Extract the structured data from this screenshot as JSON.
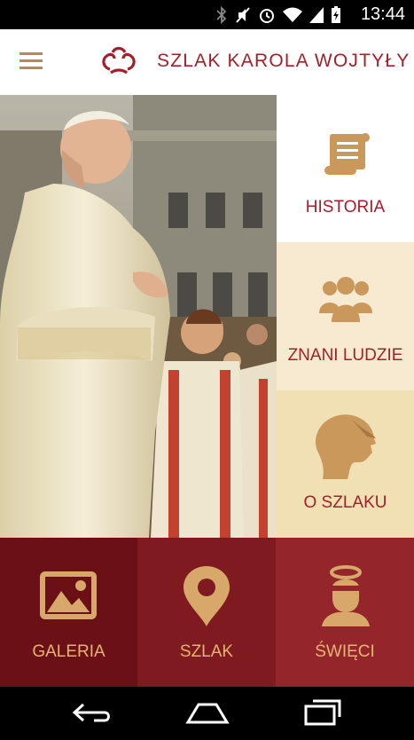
{
  "status_bar": {
    "time": "13:44",
    "icons": [
      "bluetooth-icon",
      "mute-icon",
      "alarm-icon",
      "wifi-icon",
      "signal-icon",
      "battery-charging-icon"
    ]
  },
  "app_bar": {
    "title": "SZLAK KAROLA WOJTYŁY",
    "menu_icon": "hamburger-menu-icon",
    "logo_icon": "logo-icon"
  },
  "tiles": {
    "historia": {
      "label": "HISTORIA",
      "icon": "scroll-icon"
    },
    "znani_ludzie": {
      "label": "ZNANI LUDZIE",
      "icon": "people-group-icon"
    },
    "o_szlaku": {
      "label": "O SZLAKU",
      "icon": "profile-head-icon"
    },
    "galeria": {
      "label": "GALERIA",
      "icon": "image-icon"
    },
    "szlak": {
      "label": "SZLAK",
      "icon": "map-pin-icon"
    },
    "swieci": {
      "label": "ŚWIĘCI",
      "icon": "saint-halo-icon"
    }
  },
  "colors": {
    "accent_gold": "#c0874a",
    "title_red": "#a3202a",
    "historia_bg": "#ffffff",
    "znani_bg": "#f7ead0",
    "o_szlaku_bg": "#f0e0b4",
    "galeria_bg": "#6b1016",
    "szlak_bg": "#7f1a20",
    "swieci_bg": "#94262b"
  },
  "nav_bar": {
    "back_icon": "back-icon",
    "home_icon": "home-icon",
    "recents_icon": "recents-icon"
  }
}
